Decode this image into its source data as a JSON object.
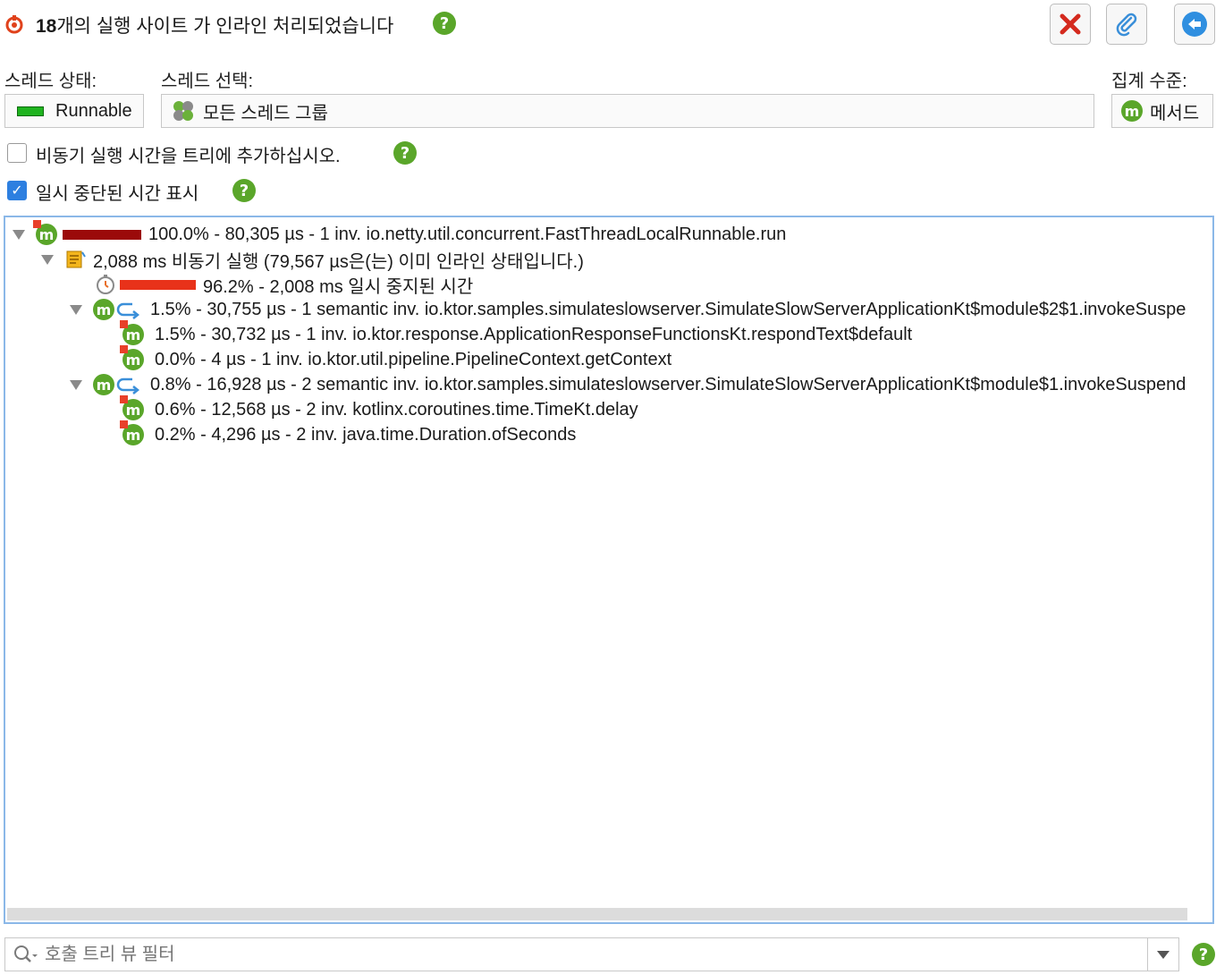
{
  "header": {
    "count": "18",
    "title_rest": "개의 실행 사이트 가 인라인 처리되었습니다",
    "help": "?"
  },
  "toolbar": {
    "close_icon": "close-icon",
    "attach_icon": "attach-icon",
    "back_icon": "back-icon"
  },
  "thread_state": {
    "label": "스레드 상태:",
    "value": "Runnable",
    "color": "#1fb31f"
  },
  "thread_select": {
    "label": "스레드 선택:",
    "value": "모든 스레드 그룹"
  },
  "aggregation": {
    "label": "집계 수준:",
    "value": "메서드"
  },
  "options": {
    "async_label": "비동기 실행 시간을 트리에 추가하십시오.",
    "async_checked": false,
    "suspended_label": "일시 중단된 시간 표시",
    "suspended_checked": true
  },
  "tree": [
    {
      "text": "100.0% - 80,305 µs - 1 inv. io.netty.util.concurrent.FastThreadLocalRunnable.run",
      "bar_color": "#9b0a0a",
      "bar_fraction": 1.0
    },
    {
      "text": "2,088 ms 비동기 실행 (79,567 µs은(는) 이미 인라인 상태입니다.)"
    },
    {
      "text": "96.2% - 2,008 ms 일시 중지된 시간",
      "bar_color": "#e8321a",
      "bar_fraction": 0.962
    },
    {
      "text": "1.5% - 30,755 µs - 1 semantic inv. io.ktor.samples.simulateslowserver.SimulateSlowServerApplicationKt$module$2$1.invokeSuspe"
    },
    {
      "text": "1.5% - 30,732 µs - 1 inv. io.ktor.response.ApplicationResponseFunctionsKt.respondText$default"
    },
    {
      "text": "0.0% - 4 µs - 1 inv. io.ktor.util.pipeline.PipelineContext.getContext"
    },
    {
      "text": "0.8% - 16,928 µs - 2 semantic inv. io.ktor.samples.simulateslowserver.SimulateSlowServerApplicationKt$module$1.invokeSuspend"
    },
    {
      "text": "0.6% - 12,568 µs - 2 inv. kotlinx.coroutines.time.TimeKt.delay"
    },
    {
      "text": "0.2% - 4,296 µs - 2 inv. java.time.Duration.ofSeconds"
    }
  ],
  "filter": {
    "placeholder": "호출 트리 뷰 필터"
  }
}
